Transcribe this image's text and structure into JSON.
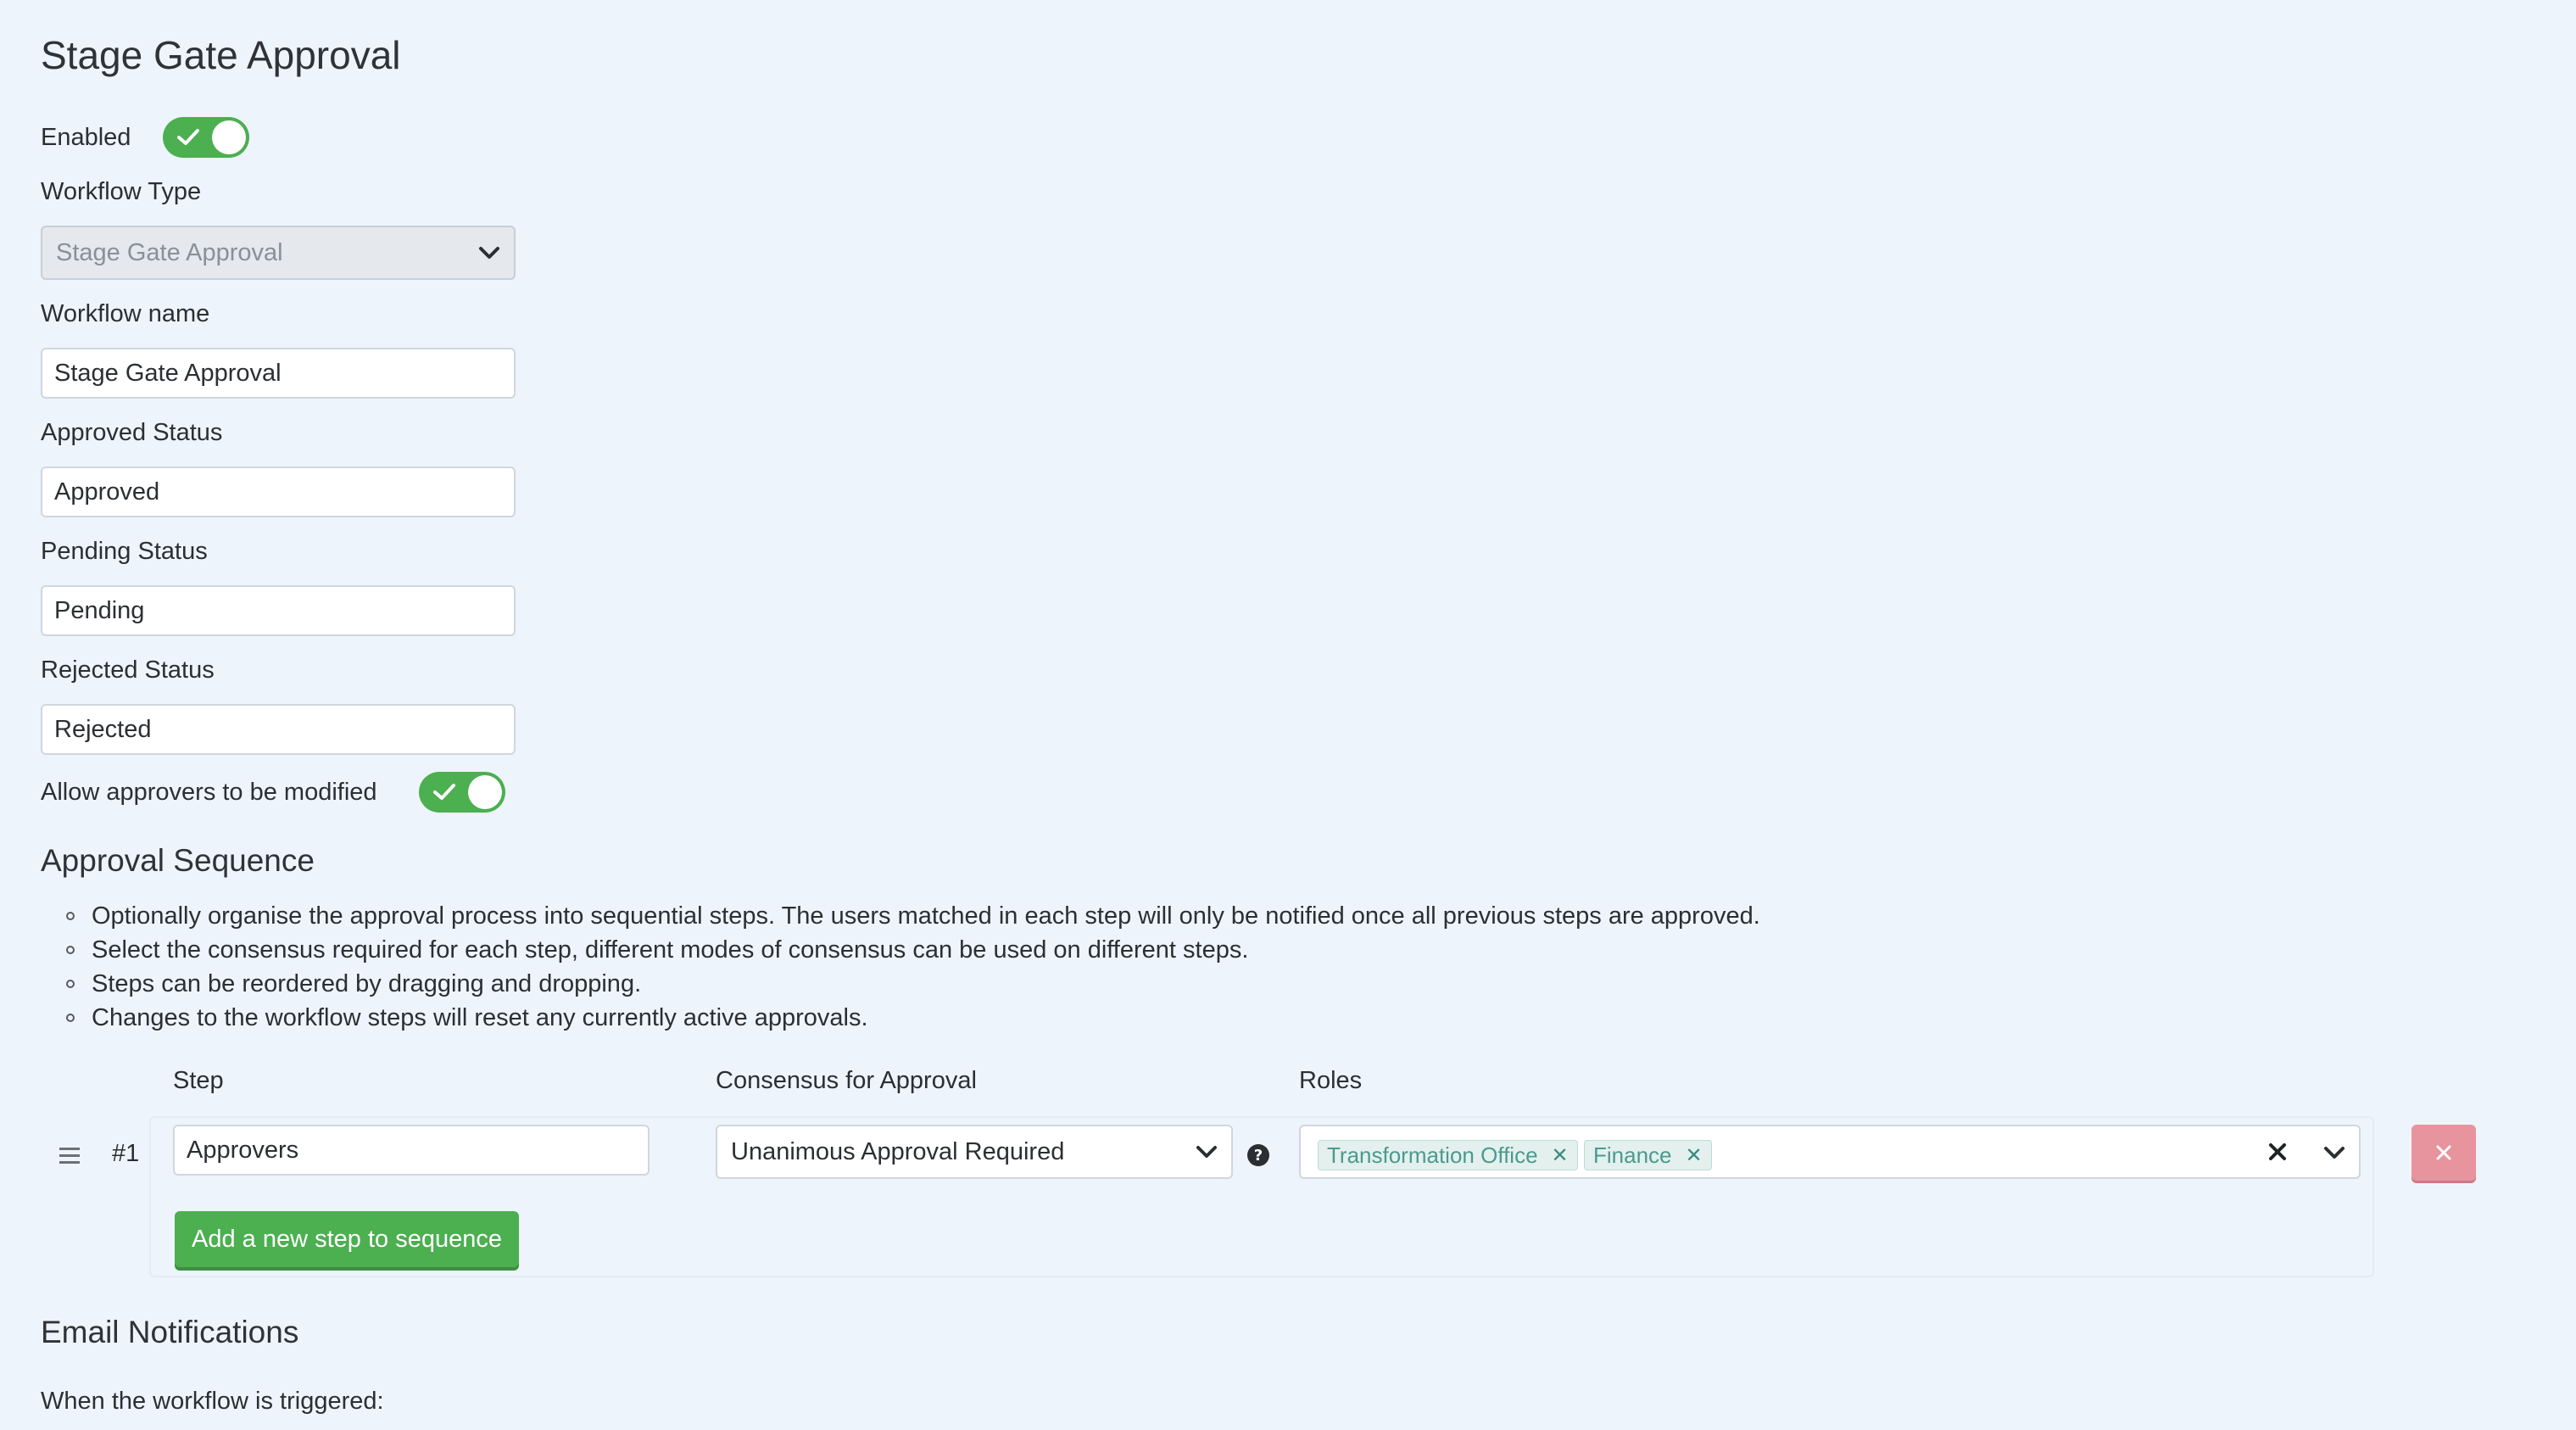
{
  "page": {
    "title": "Stage Gate Approval"
  },
  "form": {
    "enabled_label": "Enabled",
    "workflow_type_label": "Workflow Type",
    "workflow_type_value": "Stage Gate Approval",
    "workflow_name_label": "Workflow name",
    "workflow_name_value": "Stage Gate Approval",
    "approved_status_label": "Approved Status",
    "approved_status_value": "Approved",
    "pending_status_label": "Pending Status",
    "pending_status_value": "Pending",
    "rejected_status_label": "Rejected Status",
    "rejected_status_value": "Rejected",
    "allow_modify_label": "Allow approvers to be modified"
  },
  "approval_sequence": {
    "title": "Approval Sequence",
    "bullets": [
      "Optionally organise the approval process into sequential steps. The users matched in each step will only be notified once all previous steps are approved.",
      "Select the consensus required for each step, different modes of consensus can be used on different steps.",
      "Steps can be reordered by dragging and dropping.",
      "Changes to the workflow steps will reset any currently active approvals."
    ],
    "columns": {
      "step": "Step",
      "consensus": "Consensus for Approval",
      "roles": "Roles"
    },
    "steps": [
      {
        "number": "#1",
        "name": "Approvers",
        "consensus": "Unanimous Approval Required",
        "roles": [
          "Transformation Office",
          "Finance"
        ]
      }
    ],
    "add_step_label": "Add a new step to sequence"
  },
  "email_notifications": {
    "title": "Email Notifications",
    "trigger_label": "When the workflow is triggered:"
  },
  "colors": {
    "background": "#eef4fc",
    "accent_green": "#4caf50",
    "tag_text": "#4a9a8e",
    "delete_button": "#e7949f"
  },
  "icons": {
    "toggle_check": "check-icon",
    "dropdown": "chevron-down-icon",
    "drag_handle": "drag-handle-icon",
    "help": "question-circle-icon",
    "clear": "close-icon"
  }
}
